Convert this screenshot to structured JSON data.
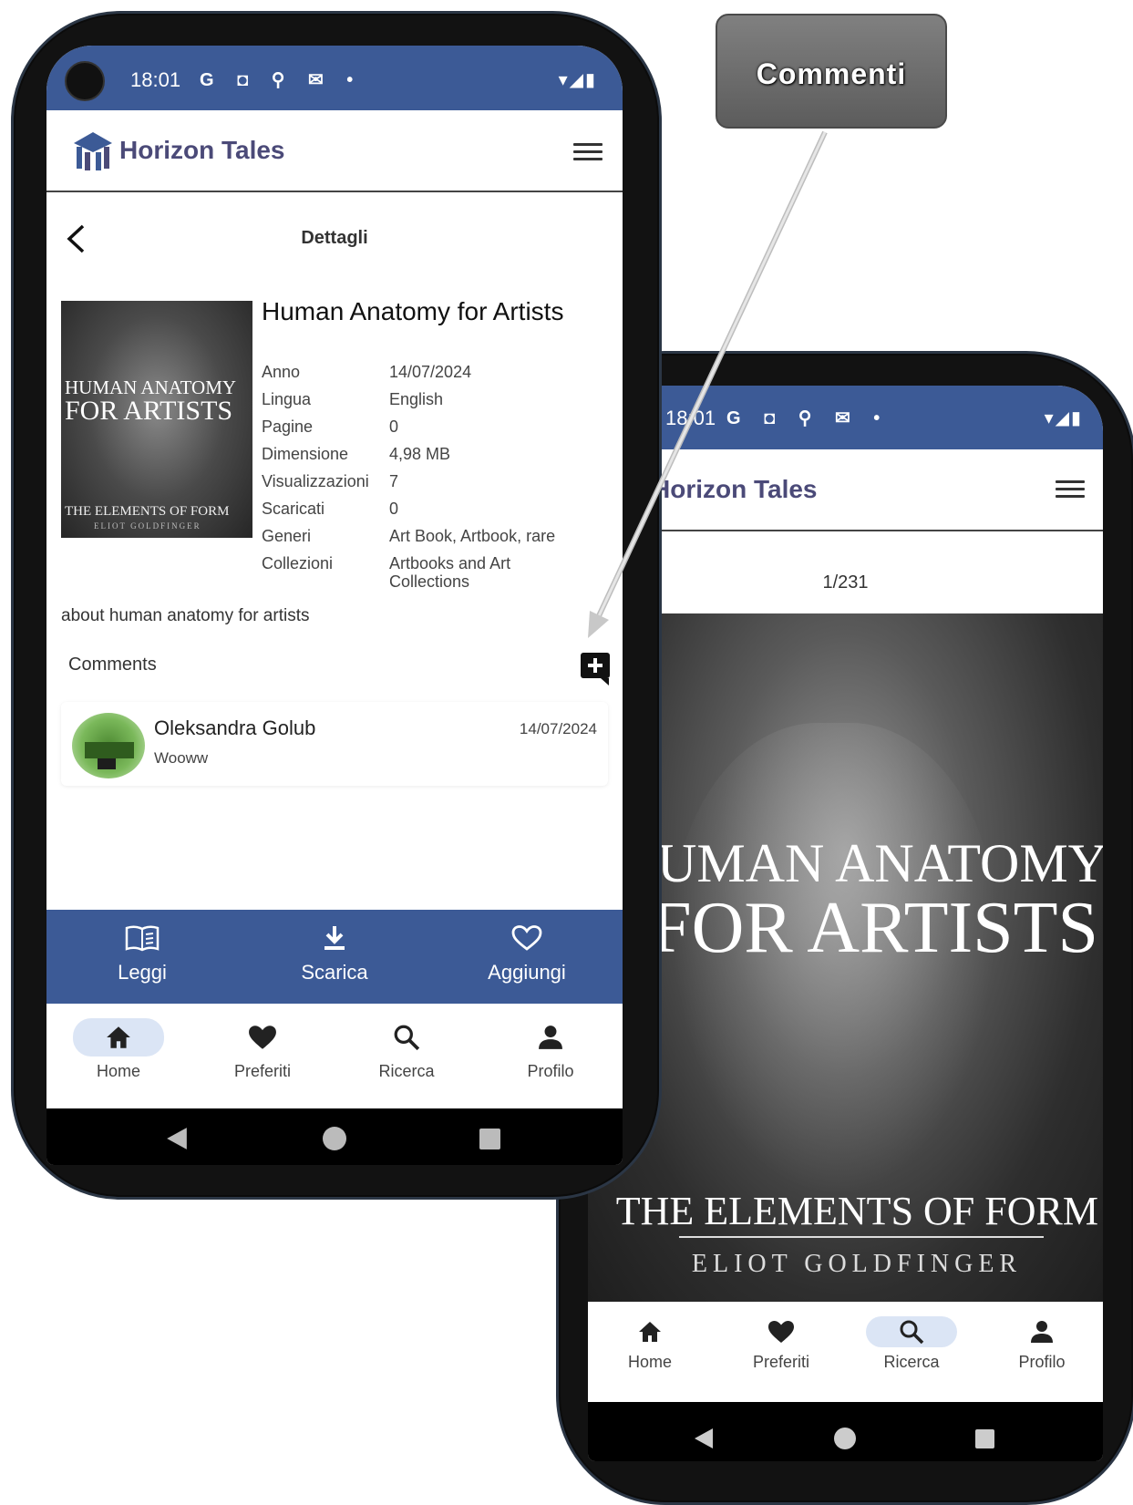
{
  "callout": {
    "label": "Commenti"
  },
  "phone_left": {
    "status": {
      "time": "18:01",
      "icons": "G ◘ ⚲ ✉ •",
      "right_icons": "▾◢▮"
    },
    "header": {
      "brand": "Horizon Tales"
    },
    "detail": {
      "title": "Dettagli",
      "book_title": "Human Anatomy for Artists",
      "cover": {
        "line1": "HUMAN ANATOMY",
        "line2": "FOR ARTISTS",
        "line3": "THE ELEMENTS OF FORM",
        "line4": "ELIOT GOLDFINGER"
      },
      "meta": [
        {
          "key": "Anno",
          "value": "14/07/2024"
        },
        {
          "key": "Lingua",
          "value": "English"
        },
        {
          "key": "Pagine",
          "value": "0"
        },
        {
          "key": "Dimensione",
          "value": "4,98 MB"
        },
        {
          "key": "Visualizzazioni",
          "value": "7"
        },
        {
          "key": "Scaricati",
          "value": "0"
        },
        {
          "key": "Generi",
          "value": "Art Book, Artbook, rare"
        },
        {
          "key": "Collezioni",
          "value": "Artbooks and Art Collections"
        }
      ],
      "description": "about human anatomy for artists",
      "comments_header": "Comments",
      "comments": [
        {
          "author": "Oleksandra Golub",
          "date": "14/07/2024",
          "text": "Wooww"
        }
      ]
    },
    "actions": [
      {
        "label": "Leggi",
        "icon": "book-icon"
      },
      {
        "label": "Scarica",
        "icon": "download-icon"
      },
      {
        "label": "Aggiungi",
        "icon": "heart-outline-icon"
      }
    ],
    "nav": [
      {
        "label": "Home",
        "icon": "home-icon",
        "active": true
      },
      {
        "label": "Preferiti",
        "icon": "heart-icon",
        "active": false
      },
      {
        "label": "Ricerca",
        "icon": "search-icon",
        "active": false
      },
      {
        "label": "Profilo",
        "icon": "person-icon",
        "active": false
      }
    ]
  },
  "phone_right": {
    "status": {
      "time": "18:01",
      "icons": "G ◘ ⚲ ✉ •",
      "right_icons": "▾◢▮"
    },
    "header": {
      "brand": "Horizon Tales"
    },
    "reader": {
      "page_indicator": "1/231",
      "cover": {
        "line1": "HUMAN ANATOMY",
        "line2": "FOR ARTISTS",
        "line3": "THE ELEMENTS OF FORM",
        "line4": "ELIOT GOLDFINGER"
      }
    },
    "nav": [
      {
        "label": "Home",
        "icon": "home-icon",
        "active": false
      },
      {
        "label": "Preferiti",
        "icon": "heart-icon",
        "active": false
      },
      {
        "label": "Ricerca",
        "icon": "search-icon",
        "active": true
      },
      {
        "label": "Profilo",
        "icon": "person-icon",
        "active": false
      }
    ]
  },
  "colors": {
    "primary": "#3c5a96",
    "brand_text": "#4b4a78",
    "active_nav": "#dbe5f5"
  }
}
